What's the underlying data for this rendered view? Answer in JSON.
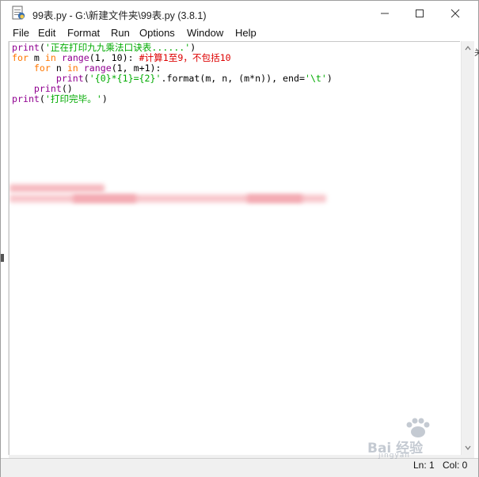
{
  "window": {
    "title": "99表.py - G:\\新建文件夹\\99表.py (3.8.1)",
    "controls": {
      "minimize": "minimize",
      "maximize": "maximize",
      "close": "close"
    }
  },
  "menu": {
    "items": [
      {
        "label": "File"
      },
      {
        "label": "Edit"
      },
      {
        "label": "Format"
      },
      {
        "label": "Run"
      },
      {
        "label": "Options"
      },
      {
        "label": "Window"
      },
      {
        "label": "Help"
      }
    ]
  },
  "editor": {
    "lines": [
      "print('正在打印九九乘法口诀表......')",
      "for m in range(1, 10): #计算1至9，不包括10",
      "    for n in range(1, m+1):",
      "        print('{0}*{1}={2}'.format(m, n, (m*n)), end='\\t')",
      "    print()",
      "print('打印完毕。')"
    ]
  },
  "status": {
    "line": "Ln: 1",
    "column": "Col: 0"
  },
  "colors": {
    "keyword": "#ff7700",
    "builtin": "#900090",
    "string": "#00aa00",
    "comment": "#dd0000",
    "blur": "#f4a8ae"
  },
  "watermark": {
    "text": "Bai 经验",
    "sub": "jingyan"
  },
  "edge": {
    "right_char": "关"
  }
}
